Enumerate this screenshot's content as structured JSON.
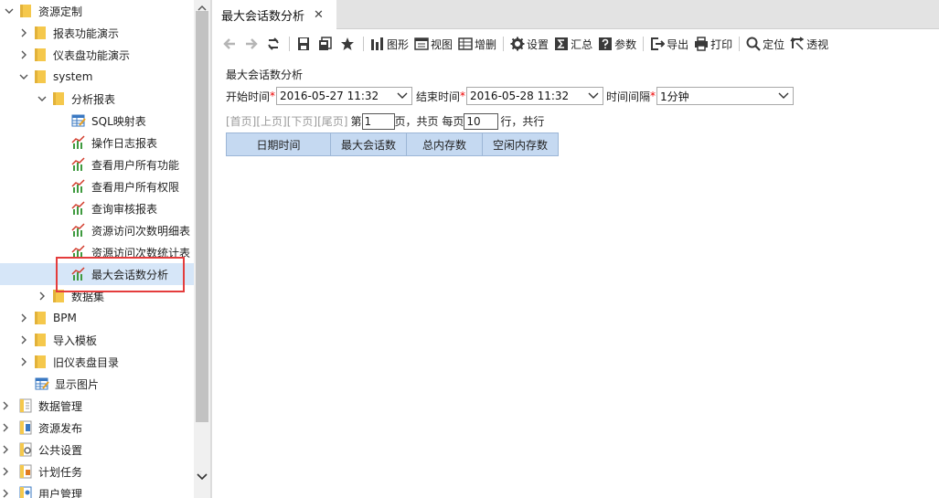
{
  "sidebar": {
    "tree": [
      {
        "label": "资源定制",
        "expanded": true,
        "icon": "folder-icon"
      },
      {
        "label": "报表功能演示",
        "expanded": false,
        "icon": "folder-icon"
      },
      {
        "label": "仪表盘功能演示",
        "expanded": false,
        "icon": "folder-icon"
      },
      {
        "label": "system",
        "expanded": true,
        "icon": "folder-icon"
      },
      {
        "label": "分析报表",
        "expanded": true,
        "icon": "folder-icon"
      },
      {
        "label": "SQL映射表",
        "icon": "table-edit-icon"
      },
      {
        "label": "操作日志报表",
        "icon": "chart-report-icon"
      },
      {
        "label": "查看用户所有功能",
        "icon": "chart-report-icon"
      },
      {
        "label": "查看用户所有权限",
        "icon": "chart-report-icon"
      },
      {
        "label": "查询审核报表",
        "icon": "chart-report-icon"
      },
      {
        "label": "资源访问次数明细表",
        "icon": "chart-report-icon"
      },
      {
        "label": "资源访问次数统计表",
        "icon": "chart-report-icon"
      },
      {
        "label": "最大会话数分析",
        "icon": "chart-report-icon",
        "selected": true
      },
      {
        "label": "数据集",
        "expanded": false,
        "icon": "folder-icon"
      },
      {
        "label": "BPM",
        "expanded": false,
        "icon": "folder-icon"
      },
      {
        "label": "导入模板",
        "expanded": false,
        "icon": "folder-icon"
      },
      {
        "label": "旧仪表盘目录",
        "expanded": false,
        "icon": "folder-icon"
      },
      {
        "label": "显示图片",
        "icon": "table-edit-icon"
      },
      {
        "label": "数据管理",
        "expanded": false,
        "icon": "doc-folder-icon"
      },
      {
        "label": "资源发布",
        "expanded": false,
        "icon": "publish-icon"
      },
      {
        "label": "公共设置",
        "expanded": false,
        "icon": "settings-doc-icon"
      },
      {
        "label": "计划任务",
        "expanded": false,
        "icon": "task-icon"
      },
      {
        "label": "用户管理",
        "expanded": false,
        "icon": "user-manage-icon"
      }
    ]
  },
  "tab": {
    "title": "最大会话数分析",
    "close": "✕"
  },
  "toolbar": {
    "back_icon": "arrow-left-icon",
    "forward_icon": "arrow-right-icon",
    "refresh_icon": "refresh-icon",
    "save_icon": "save-icon",
    "saveas_icon": "save-as-icon",
    "favorite_icon": "star-icon",
    "chart_label": "图形",
    "view_label": "视图",
    "edit_label": "增删",
    "settings_label": "设置",
    "summary_label": "汇总",
    "params_label": "参数",
    "export_label": "导出",
    "print_label": "打印",
    "locate_label": "定位",
    "pivot_label": "透视"
  },
  "report": {
    "title": "最大会话数分析",
    "start_label": "开始时间",
    "start_value": "2016-05-27 11:32",
    "end_label": "结束时间",
    "end_value": "2016-05-28 11:32",
    "interval_label": "时间间隔",
    "interval_value": "1分钟",
    "required_mark": "*"
  },
  "pager": {
    "first": "[首页]",
    "prev": "[上页]",
    "next": "[下页]",
    "last": "[尾页]",
    "page_prefix": "第",
    "page_value": "1",
    "page_suffix": "页，共页 每页",
    "per_page_value": "10",
    "rows_suffix": "行，共行"
  },
  "grid": {
    "columns": [
      "日期时间",
      "最大会话数",
      "总内存数",
      "空闲内存数"
    ]
  },
  "colors": {
    "folder": "#f5c84c",
    "selected_row": "#d6e6f8",
    "highlight_box": "#e43c3c",
    "grid_header": "#c5d9f1",
    "toolbar_icon": "#3a3a3a"
  }
}
